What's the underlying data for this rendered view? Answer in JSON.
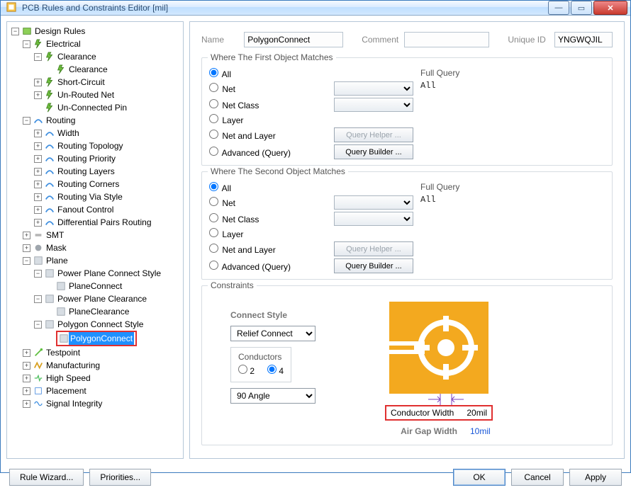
{
  "window": {
    "title": "PCB Rules and Constraints Editor [mil]"
  },
  "tree": {
    "root": "Design Rules",
    "electrical": "Electrical",
    "clearance_parent": "Clearance",
    "clearance": "Clearance",
    "short_circuit": "Short-Circuit",
    "unrouted_net": "Un-Routed Net",
    "unconnected_pin": "Un-Connected Pin",
    "routing": "Routing",
    "width": "Width",
    "routing_topology": "Routing Topology",
    "routing_priority": "Routing Priority",
    "routing_layers": "Routing Layers",
    "routing_corners": "Routing Corners",
    "routing_via_style": "Routing Via Style",
    "fanout_control": "Fanout Control",
    "diff_pairs": "Differential Pairs Routing",
    "smt": "SMT",
    "mask": "Mask",
    "plane": "Plane",
    "pp_connect_style": "Power Plane Connect Style",
    "plane_connect": "PlaneConnect",
    "pp_clearance": "Power Plane Clearance",
    "plane_clearance": "PlaneClearance",
    "poly_connect_style": "Polygon Connect Style",
    "polygon_connect": "PolygonConnect",
    "testpoint": "Testpoint",
    "manufacturing": "Manufacturing",
    "high_speed": "High Speed",
    "placement": "Placement",
    "signal_integrity": "Signal Integrity"
  },
  "form": {
    "name_label": "Name",
    "name_value": "PolygonConnect",
    "comment_label": "Comment",
    "comment_value": "",
    "uid_label": "Unique ID",
    "uid_value": "YNGWQJIL"
  },
  "match1": {
    "legend": "Where The First Object Matches",
    "all": "All",
    "net": "Net",
    "net_class": "Net Class",
    "layer": "Layer",
    "net_and_layer": "Net and Layer",
    "advanced": "Advanced (Query)",
    "query_helper": "Query Helper ...",
    "query_builder": "Query Builder ...",
    "full_query_label": "Full Query",
    "full_query": "All"
  },
  "match2": {
    "legend": "Where The Second Object Matches",
    "all": "All",
    "net": "Net",
    "net_class": "Net Class",
    "layer": "Layer",
    "net_and_layer": "Net and Layer",
    "advanced": "Advanced (Query)",
    "query_helper": "Query Helper ...",
    "query_builder": "Query Builder ...",
    "full_query_label": "Full Query",
    "full_query": "All"
  },
  "constraints": {
    "legend": "Constraints",
    "connect_style_label": "Connect Style",
    "connect_style_value": "Relief Connect",
    "conductors_label": "Conductors",
    "conductors_2": "2",
    "conductors_4": "4",
    "angle_value": "90 Angle",
    "conductor_width_label": "Conductor Width",
    "conductor_width_value": "20mil",
    "air_gap_label": "Air Gap Width",
    "air_gap_value": "10mil"
  },
  "footer": {
    "rule_wizard": "Rule Wizard...",
    "priorities": "Priorities...",
    "ok": "OK",
    "cancel": "Cancel",
    "apply": "Apply"
  }
}
